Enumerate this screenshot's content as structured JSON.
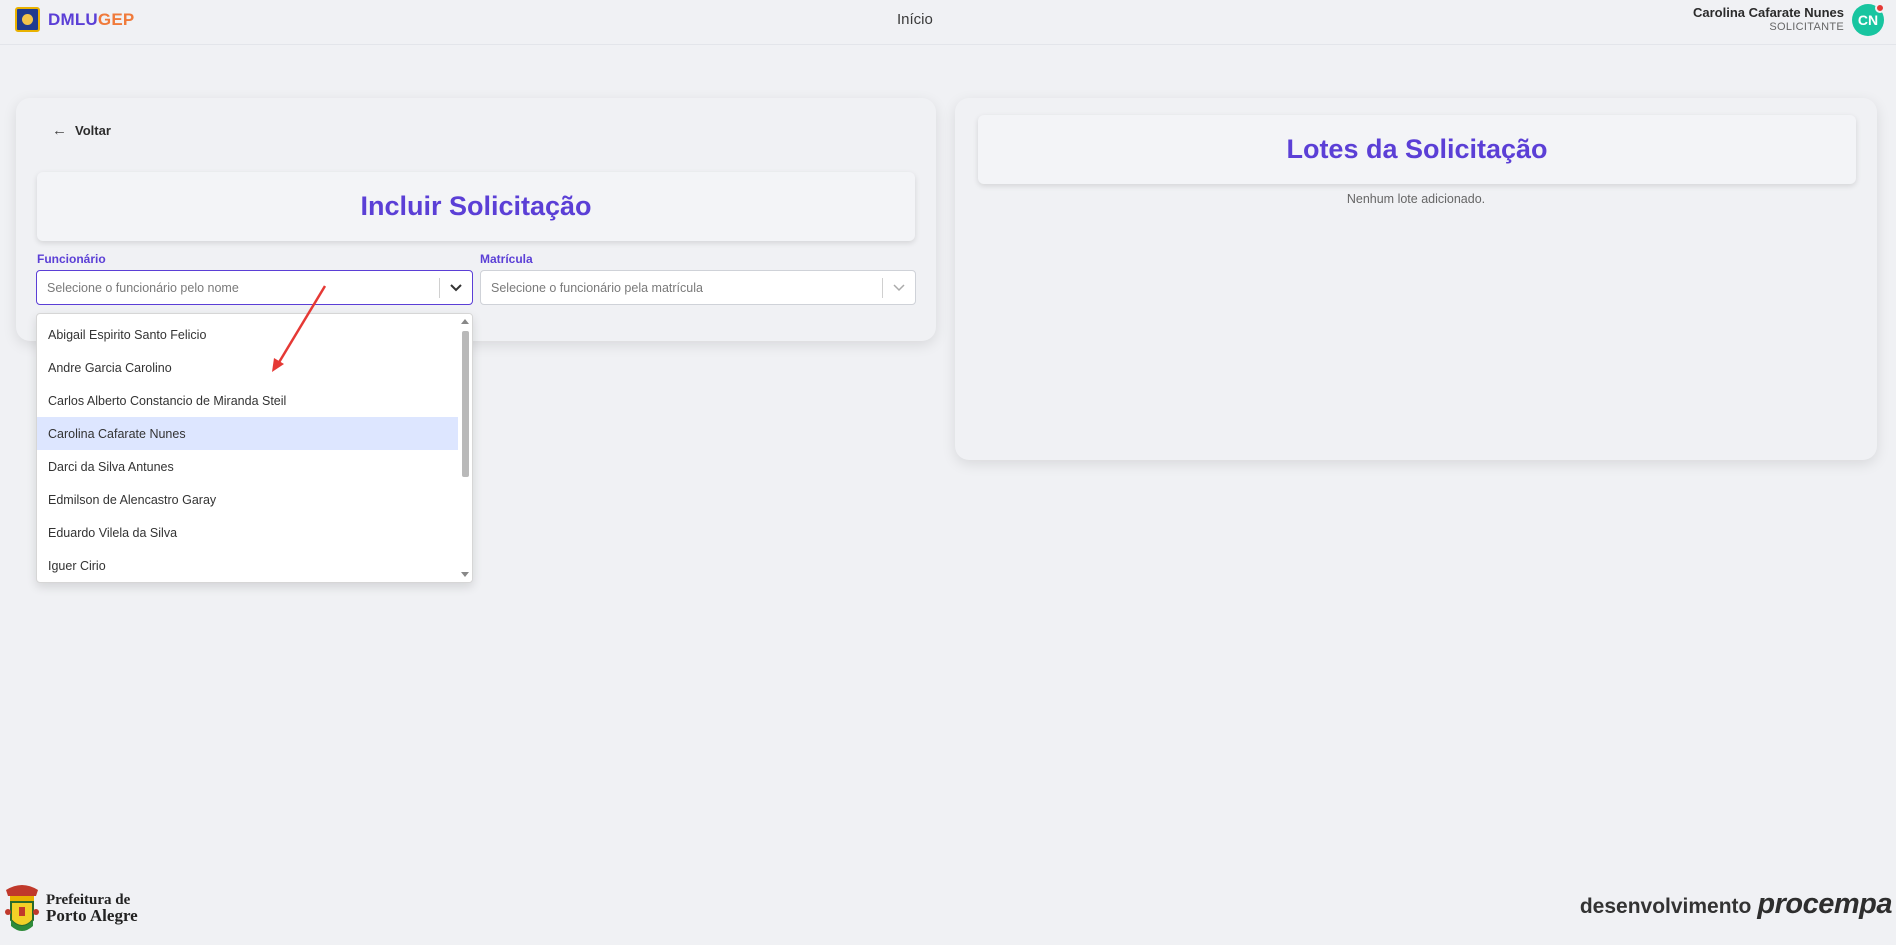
{
  "header": {
    "brand_part1": "DMLU",
    "brand_part2": "GEP",
    "nav_home": "Início",
    "user_name": "Carolina Cafarate Nunes",
    "user_role": "SOLICITANTE",
    "user_initials": "CN"
  },
  "form": {
    "back_label": "Voltar",
    "title": "Incluir Solicitação",
    "funcionario_label": "Funcionário",
    "funcionario_placeholder": "Selecione o funcionário pelo nome",
    "matricula_label": "Matrícula",
    "matricula_placeholder": "Selecione o funcionário pela matrícula"
  },
  "dropdown": {
    "options": [
      "Abigail Espirito Santo Felicio",
      "Andre Garcia Carolino",
      "Carlos Alberto Constancio de Miranda Steil",
      "Carolina Cafarate Nunes",
      "Darci da Silva Antunes",
      "Edmilson de Alencastro Garay",
      "Eduardo Vilela da Silva",
      "Iguer Cirio"
    ],
    "highlighted": "Carolina Cafarate Nunes"
  },
  "lotes": {
    "title": "Lotes da Solicitação",
    "empty_text": "Nenhum lote adicionado."
  },
  "footer": {
    "prefeitura_line1": "Prefeitura de",
    "prefeitura_line2": "Porto Alegre",
    "dev_label": "desenvolvimento",
    "dev_brand": "procempa"
  },
  "colors": {
    "accent": "#5b3fd6",
    "brand_orange": "#f07a3a",
    "avatar": "#18c5a0",
    "highlight": "#dde6ff",
    "annotation_arrow": "#e53935"
  },
  "icons": {
    "back": "arrow-left-icon",
    "chevron": "chevron-down-icon",
    "notification": "notification-dot-icon"
  }
}
